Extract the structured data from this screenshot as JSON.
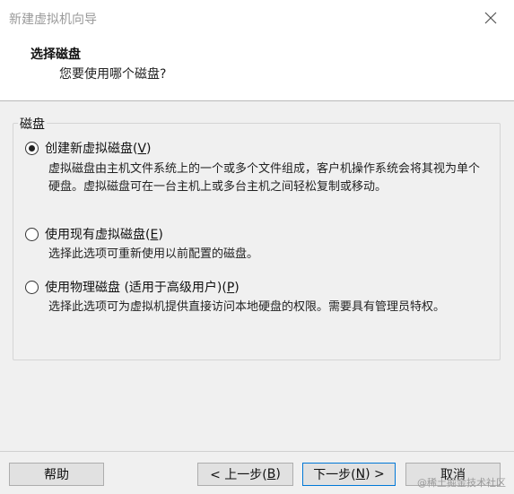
{
  "window": {
    "title": "新建虚拟机向导"
  },
  "header": {
    "title": "选择磁盘",
    "subtitle": "您要使用哪个磁盘?"
  },
  "group": {
    "legend": "磁盘"
  },
  "options": [
    {
      "label": "创建新虚拟磁盘(",
      "key": "V",
      "suffix": ")",
      "checked": true,
      "description": "虚拟磁盘由主机文件系统上的一个或多个文件组成，客户机操作系统会将其视为单个硬盘。虚拟磁盘可在一台主机上或多台主机之间轻松复制或移动。"
    },
    {
      "label": "使用现有虚拟磁盘(",
      "key": "E",
      "suffix": ")",
      "checked": false,
      "description": "选择此选项可重新使用以前配置的磁盘。"
    },
    {
      "label": "使用物理磁盘 (适用于高级用户)(",
      "key": "P",
      "suffix": ")",
      "checked": false,
      "description": "选择此选项可为虚拟机提供直接访问本地硬盘的权限。需要具有管理员特权。"
    }
  ],
  "buttons": {
    "help": "帮助",
    "back_prefix": "< 上一步(",
    "back_key": "B",
    "back_suffix": ")",
    "next_prefix": "下一步(",
    "next_key": "N",
    "next_suffix": ") >",
    "cancel": "取消"
  },
  "watermark": "@稀土掘金技术社区",
  "icons": {
    "close": "close-icon"
  }
}
